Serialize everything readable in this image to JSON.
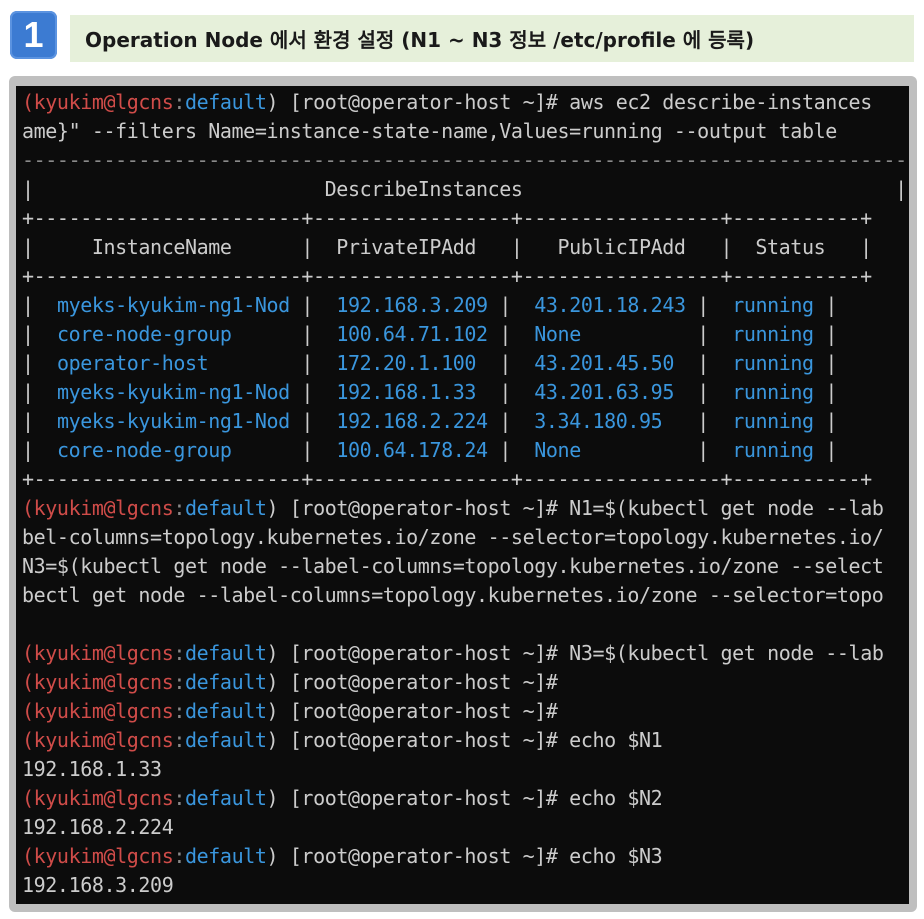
{
  "header": {
    "step_number": "1",
    "title": "Operation Node 에서 환경 설정 (N1 ~ N3 정보 /etc/profile 에 등록)"
  },
  "terminal": {
    "prompt_user": "(kyukim@lgcns",
    "prompt_sep": ":",
    "prompt_profile": "default",
    "prompt_rest": ") [root@operator-host ~]# ",
    "cmd_aws": "aws ec2 describe-instances",
    "cmd_aws_wrap": "ame}\" --filters Name=instance-state-name,Values=running --output table",
    "table_border_top": "----------------------------------------------------------------------------",
    "table_title_line": "|                         DescribeInstances                                |",
    "table_sep": "+-----------------------+-----------------+-----------------+-----------+",
    "table_headers": [
      "InstanceName",
      "PrivateIPAdd",
      "PublicIPAdd",
      "Status"
    ],
    "rows": [
      {
        "name": "myeks-kyukim-ng1-Node",
        "private": "192.168.3.209",
        "public": "43.201.18.243",
        "status": "running"
      },
      {
        "name": "core-node-group",
        "private": "100.64.71.102",
        "public": "None",
        "status": "running"
      },
      {
        "name": "operator-host",
        "private": "172.20.1.100",
        "public": "43.201.45.50",
        "status": "running"
      },
      {
        "name": "myeks-kyukim-ng1-Node",
        "private": "192.168.1.33",
        "public": "43.201.63.95",
        "status": "running"
      },
      {
        "name": "myeks-kyukim-ng1-Node",
        "private": "192.168.2.224",
        "public": "3.34.180.95",
        "status": "running"
      },
      {
        "name": "core-node-group",
        "private": "100.64.178.24",
        "public": "None",
        "status": "running"
      }
    ],
    "cmd_n1": "N1=$(kubectl get node --lab",
    "wrap1": "bel-columns=topology.kubernetes.io/zone --selector=topology.kubernetes.io/",
    "wrap2": "N3=$(kubectl get node --label-columns=topology.kubernetes.io/zone --select",
    "wrap3": "bectl get node --label-columns=topology.kubernetes.io/zone --selector=topo",
    "cmd_n3": "N3=$(kubectl get node --lab",
    "cmd_echo1": "echo $N1",
    "out1": "192.168.1.33",
    "cmd_echo2": "echo $N2",
    "out2": "192.168.2.224",
    "cmd_echo3": "echo $N3",
    "out3": "192.168.3.209"
  }
}
